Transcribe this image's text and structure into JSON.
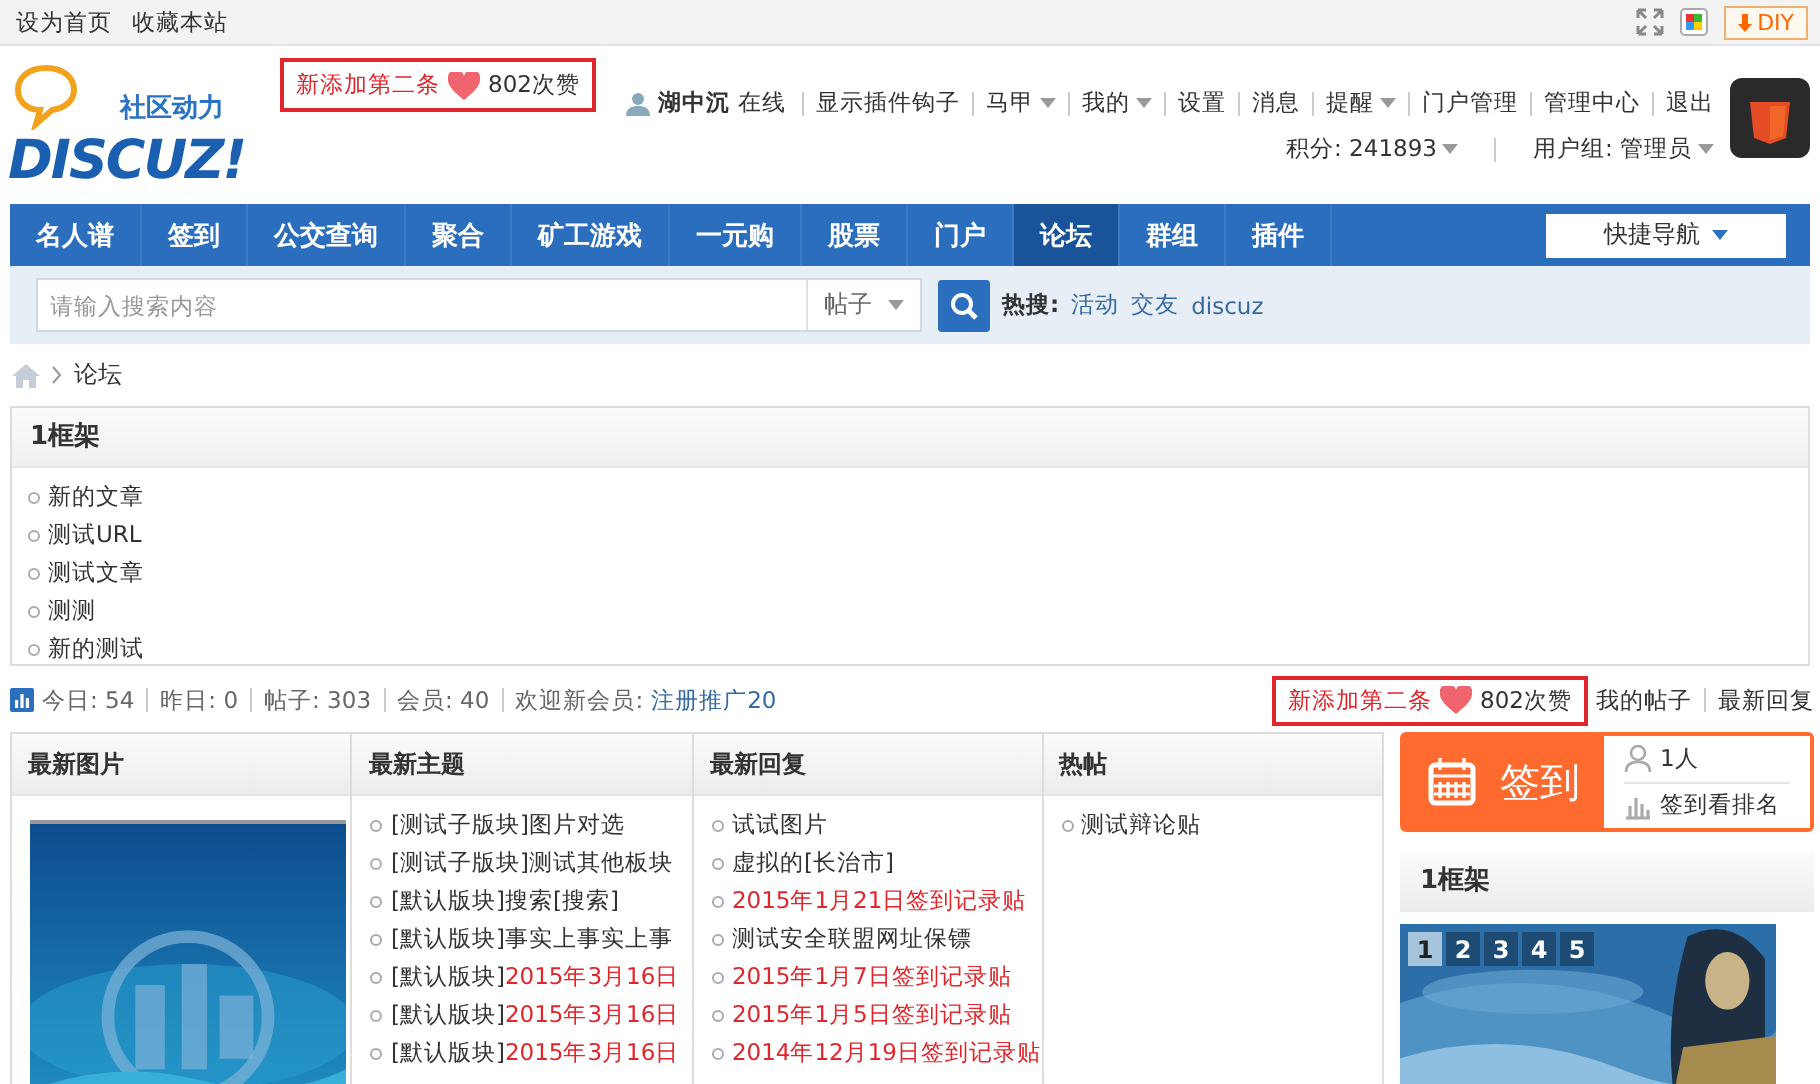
{
  "topbar": {
    "links": [
      "设为首页",
      "收藏本站"
    ],
    "diy": "DIY"
  },
  "logo": {
    "tagline": "社区动力",
    "wordmark": "DISCUZ!"
  },
  "promo": {
    "text": "新添加第二条",
    "count": "802次赞"
  },
  "user": {
    "name": "湖中沉",
    "status": "在线",
    "links": [
      {
        "label": "显示插件钩子",
        "dropdown": false
      },
      {
        "label": "马甲",
        "dropdown": true
      },
      {
        "label": "我的",
        "dropdown": true
      },
      {
        "label": "设置",
        "dropdown": false
      },
      {
        "label": "消息",
        "dropdown": false
      },
      {
        "label": "提醒",
        "dropdown": true
      },
      {
        "label": "门户管理",
        "dropdown": false
      },
      {
        "label": "管理中心",
        "dropdown": false
      },
      {
        "label": "退出",
        "dropdown": false
      }
    ],
    "credits": "积分: 241893",
    "group": "用户组: 管理员"
  },
  "nav": {
    "items": [
      {
        "label": "名人谱",
        "selected": false
      },
      {
        "label": "签到",
        "selected": false
      },
      {
        "label": "公交查询",
        "selected": false
      },
      {
        "label": "聚合",
        "selected": false
      },
      {
        "label": "矿工游戏",
        "selected": false
      },
      {
        "label": "一元购",
        "selected": false
      },
      {
        "label": "股票",
        "selected": false
      },
      {
        "label": "门户",
        "selected": false
      },
      {
        "label": "论坛",
        "selected": true
      },
      {
        "label": "群组",
        "selected": false
      },
      {
        "label": "插件",
        "selected": false
      }
    ],
    "quick": "快捷导航"
  },
  "search": {
    "placeholder": "请输入搜索内容",
    "scope": "帖子",
    "hot_label": "热搜:",
    "hot": [
      "活动",
      "交友",
      "discuz"
    ]
  },
  "breadcrumb": [
    "论坛"
  ],
  "frame": {
    "title": "1框架",
    "items": [
      "新的文章",
      "测试URL",
      "测试文章",
      "测测",
      "新的测试"
    ]
  },
  "stats": {
    "items": [
      "今日: 54",
      "昨日: 0",
      "帖子: 303",
      "会员: 40"
    ],
    "welcome": "欢迎新会员:",
    "new_member": "注册推广20",
    "promo": {
      "text": "新添加第二条",
      "count": "802次赞"
    },
    "links": [
      "我的帖子",
      "最新回复"
    ]
  },
  "columns": [
    {
      "title": "最新图片",
      "kind": "picture"
    },
    {
      "title": "最新主题",
      "kind": "list",
      "items": [
        {
          "prefix": "[测试子版块]",
          "title": "图片对选",
          "highlight": false
        },
        {
          "prefix": "[测试子版块]",
          "title": "测试其他板块",
          "highlight": false
        },
        {
          "prefix": "[默认版块]",
          "title": "搜索[搜索]",
          "highlight": false
        },
        {
          "prefix": "[默认版块]",
          "title": "事实上事实上事",
          "highlight": false
        },
        {
          "prefix": "[默认版块]",
          "title": "2015年3月16日",
          "highlight": true
        },
        {
          "prefix": "[默认版块]",
          "title": "2015年3月16日",
          "highlight": true
        },
        {
          "prefix": "[默认版块]",
          "title": "2015年3月16日",
          "highlight": true
        }
      ]
    },
    {
      "title": "最新回复",
      "kind": "list",
      "items": [
        {
          "title": "试试图片",
          "highlight": false
        },
        {
          "title": "虚拟的[长治市]",
          "highlight": false
        },
        {
          "title": "2015年1月21日签到记录贴",
          "highlight": true
        },
        {
          "title": "测试安全联盟网址保镖",
          "highlight": false
        },
        {
          "title": "2015年1月7日签到记录贴",
          "highlight": true
        },
        {
          "title": "2015年1月5日签到记录贴",
          "highlight": true
        },
        {
          "title": "2014年12月19日签到记录贴",
          "highlight": true
        }
      ]
    },
    {
      "title": "热帖",
      "kind": "list",
      "items": [
        {
          "title": "测试辩论贴",
          "highlight": false
        }
      ]
    }
  ],
  "signin": {
    "label": "签到",
    "count": "1人",
    "rank": "签到看排名"
  },
  "side_frame": {
    "title": "1框架",
    "slides": [
      {
        "label": "1",
        "selected": true
      },
      {
        "label": "2",
        "selected": false
      },
      {
        "label": "3",
        "selected": false
      },
      {
        "label": "4",
        "selected": false
      },
      {
        "label": "5",
        "selected": false
      }
    ]
  }
}
